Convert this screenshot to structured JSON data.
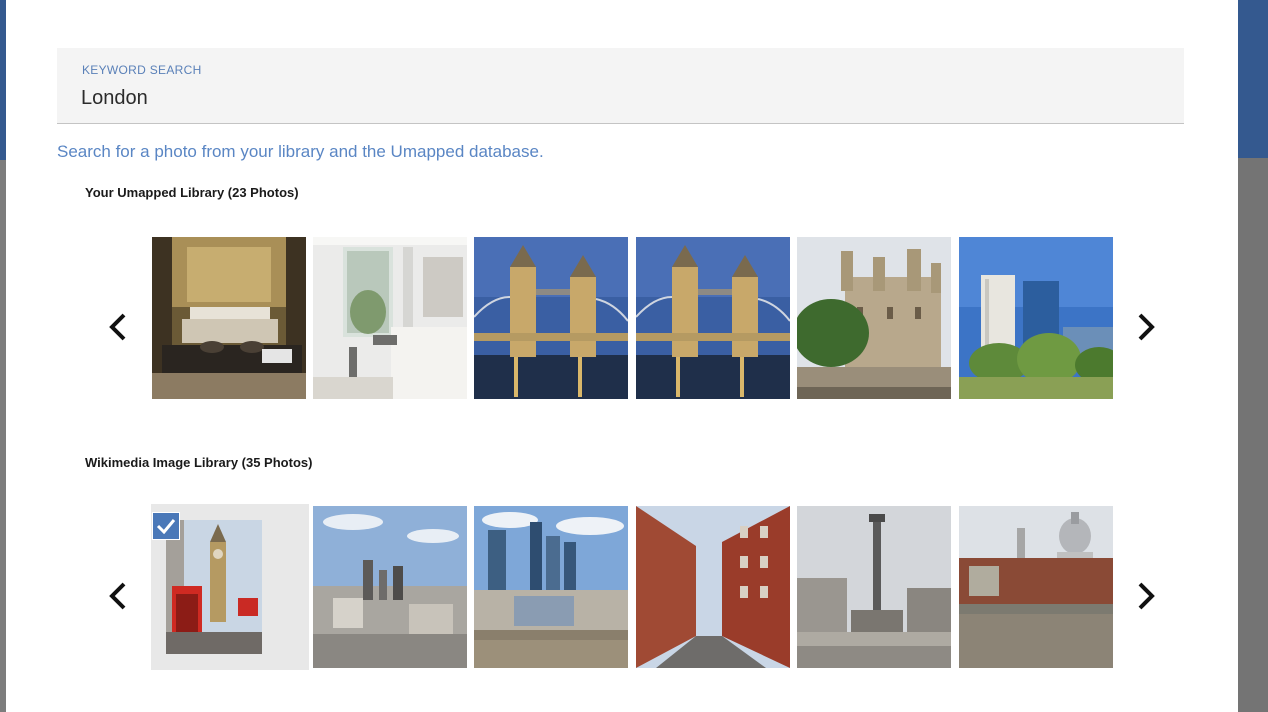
{
  "search": {
    "label": "KEYWORD SEARCH",
    "value": "London"
  },
  "helper_text": "Search for a photo from your library and the Umapped database.",
  "sections": [
    {
      "title": "Your Umapped Library (23 Photos)",
      "photos": [
        {
          "name": "hotel-room-photo"
        },
        {
          "name": "bedroom-photo"
        },
        {
          "name": "tower-bridge-photo"
        },
        {
          "name": "tower-bridge-photo"
        },
        {
          "name": "tower-of-london-photo"
        },
        {
          "name": "office-buildings-photo"
        }
      ]
    },
    {
      "title": "Wikimedia Image Library (35 Photos)",
      "selected_index": 0,
      "photos": [
        {
          "name": "big-ben-phone-box-photo"
        },
        {
          "name": "skyline-photo"
        },
        {
          "name": "city-of-london-photo"
        },
        {
          "name": "street-photo"
        },
        {
          "name": "nelsons-column-photo"
        },
        {
          "name": "st-pauls-photo"
        }
      ]
    }
  ],
  "icons": {
    "prev": "chevron-left-icon",
    "next": "chevron-right-icon",
    "check": "checkmark-icon"
  },
  "colors": {
    "accent": "#4a78b8",
    "helper": "#5a86c4",
    "brand_strip": "#34598f"
  }
}
